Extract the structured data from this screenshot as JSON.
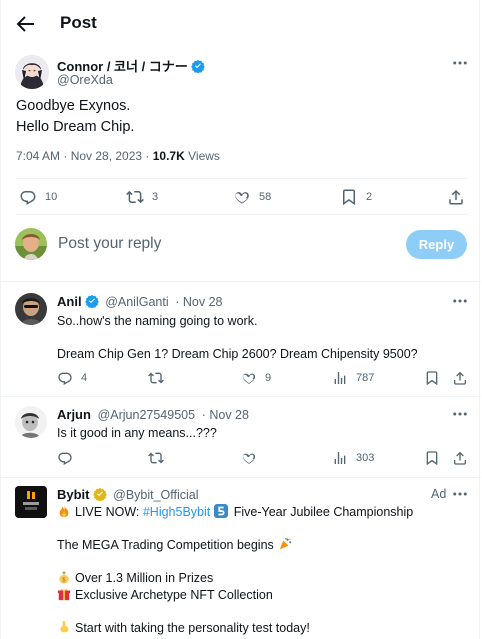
{
  "header": {
    "title": "Post"
  },
  "main_tweet": {
    "author_name": "Connor / 코너 / コナー",
    "handle": "@OreXda",
    "lines": [
      "Goodbye Exynos.",
      "Hello Dream Chip."
    ],
    "timestamp": "7:04 AM · Nov 28, 2023 · ",
    "views_count": "10.7K",
    "views_label": " Views",
    "actions": {
      "replies": "10",
      "reposts": "3",
      "likes": "58",
      "bookmarks": "2"
    }
  },
  "composer": {
    "placeholder": "Post your reply",
    "button_label": "Reply"
  },
  "replies": [
    {
      "author_name": "Anil",
      "handle": "@AnilGanti",
      "date": "· Nov 28",
      "lines": [
        "So..how's the naming going to work.",
        "",
        "Dream Chip Gen 1? Dream Chip 2600? Dream Chipensity 9500?"
      ],
      "actions": {
        "replies": "4",
        "reposts": "",
        "likes": "9",
        "views": "787"
      }
    },
    {
      "author_name": "Arjun",
      "handle": "@Arjun27549505",
      "date": "· Nov 28",
      "lines": [
        "Is it good in any means...???"
      ],
      "actions": {
        "replies": "",
        "reposts": "",
        "likes": "",
        "views": "303"
      }
    }
  ],
  "ad": {
    "author_name": "Bybit",
    "handle": "@Bybit_Official",
    "ad_label": "Ad",
    "line1_prefix": "LIVE NOW: ",
    "line1_hashtag": "#High5Bybit",
    "line1_suffix": " Five-Year Jubilee Championship",
    "line2": "The MEGA Trading Competition begins",
    "line3": "Over 1.3 Million in Prizes",
    "line4": "Exclusive Archetype NFT Collection",
    "line5": "Start with taking the personality test today!"
  },
  "colors": {
    "accent": "#1d9bf0",
    "muted": "#536471",
    "reply_button": "#8ecdf8",
    "gold": "#e2b719"
  }
}
